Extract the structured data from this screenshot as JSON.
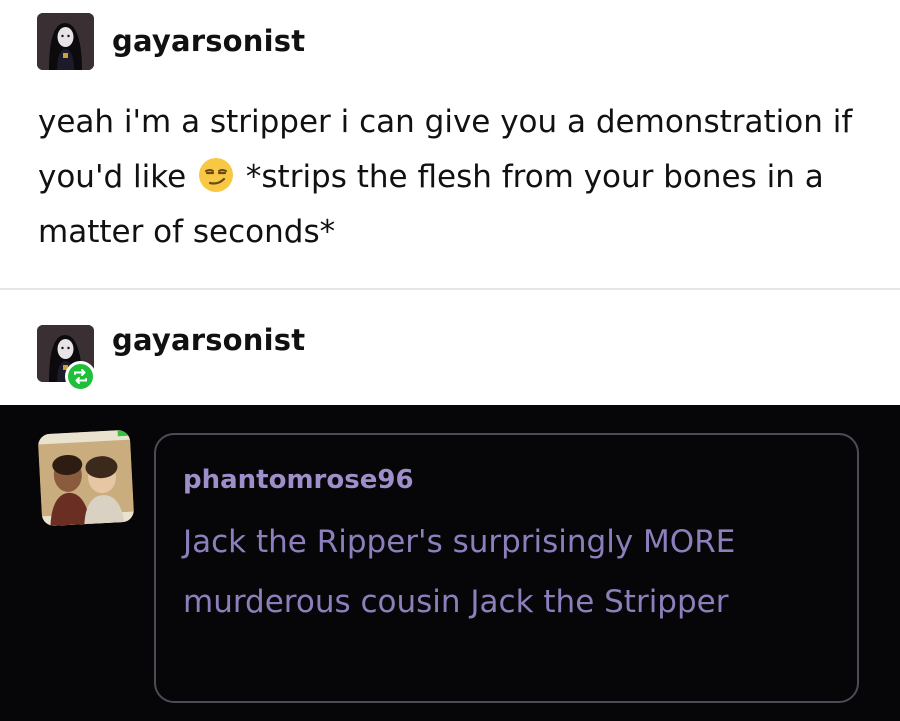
{
  "post1": {
    "username": "gayarsonist",
    "text_before_emoji": "yeah i'm a stripper i can give you a demonstration if you'd like",
    "emoji_icon": "smirking-face-emoji",
    "text_after_emoji": "*strips the flesh from your bones in a matter of seconds*"
  },
  "post2": {
    "username": "gayarsonist",
    "badge_icon": "reblog-icon",
    "badge_color": "#1fbf3a"
  },
  "reply": {
    "username": "phantomrose96",
    "text": "Jack the Ripper's surprisingly MORE murderous cousin Jack the Stripper",
    "text_color": "#8d7fbb"
  }
}
